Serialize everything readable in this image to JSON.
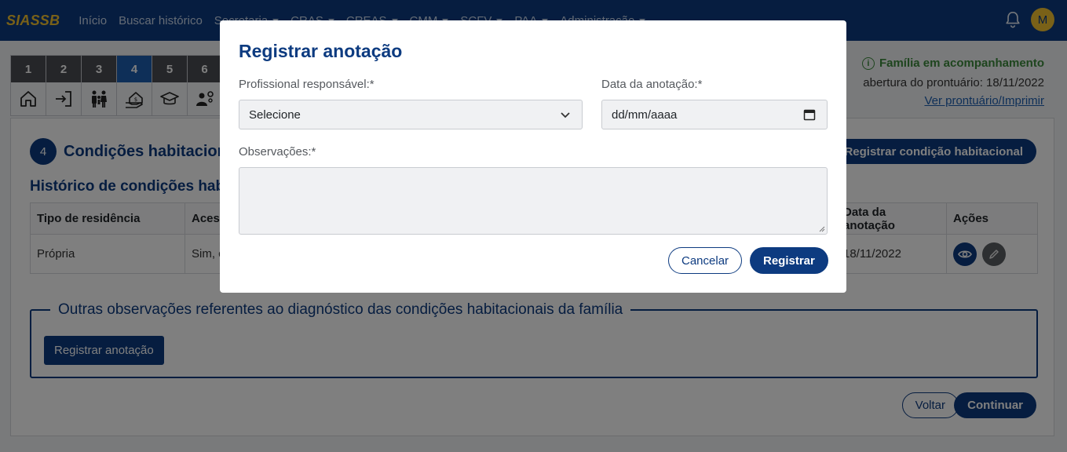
{
  "navbar": {
    "brand": "SIASSB",
    "links": [
      "Início",
      "Buscar histórico"
    ],
    "menus": [
      "Secretaria",
      "CRAS",
      "CREAS",
      "CMM",
      "SCFV",
      "PAA",
      "Administração"
    ],
    "avatar_initial": "M"
  },
  "steps": [
    {
      "num": "1",
      "icon": "home-icon"
    },
    {
      "num": "2",
      "icon": "sign-in-icon"
    },
    {
      "num": "3",
      "icon": "family-icon"
    },
    {
      "num": "4",
      "icon": "house-hand-icon",
      "active": true
    },
    {
      "num": "5",
      "icon": "graduation-cap-icon"
    },
    {
      "num": "6",
      "icon": "worker-gear-icon"
    }
  ],
  "status": {
    "chip": "Família em acompanhamento",
    "opening_date": "abertura do prontuário: 18/11/2022",
    "print_link": "Ver prontuário/Imprimir"
  },
  "section": {
    "number": "4",
    "title": "Condições habitacionais",
    "register_button": "Registrar condição habitacional",
    "history_title": "Histórico de condições habitacionais"
  },
  "table": {
    "headers": [
      "Tipo de residência",
      "Acesso",
      "Data da anotação",
      "Ações"
    ],
    "rows": [
      {
        "tipo": "Própria",
        "acesso": "Sim, com",
        "data": "18/11/2022"
      }
    ]
  },
  "observacoes": {
    "legend": "Outras observações referentes ao diagnóstico das condições habitacionais da família",
    "button": "Registrar anotação"
  },
  "footer": {
    "back": "Voltar",
    "continue": "Continuar"
  },
  "modal": {
    "title": "Registrar anotação",
    "professional_label": "Profissional responsável:*",
    "professional_value": "Selecione",
    "date_label": "Data da anotação:*",
    "date_placeholder": "dd/mm/aaaa",
    "notes_label": "Observações:*",
    "cancel": "Cancelar",
    "submit": "Registrar"
  },
  "colors": {
    "primary": "#0d3b80",
    "brand_yellow": "#f2c230",
    "success": "#3c8a3c"
  }
}
